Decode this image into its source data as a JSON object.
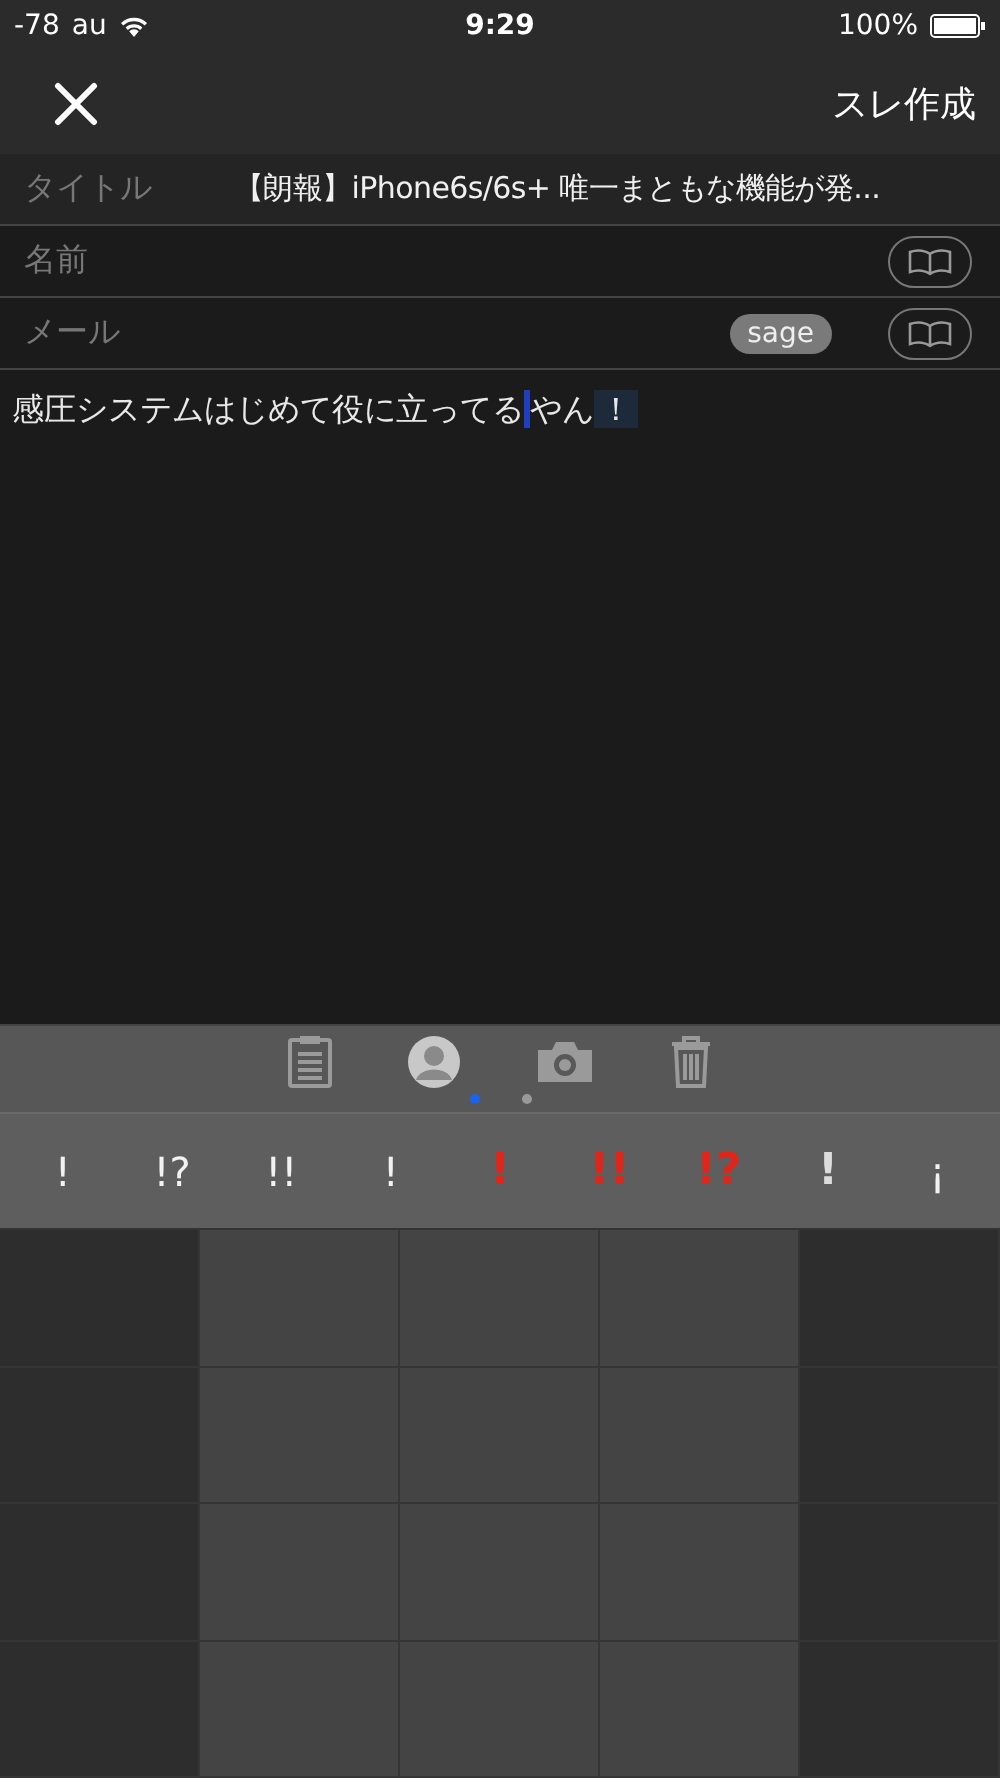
{
  "status_bar": {
    "signal": "-78",
    "carrier": "au",
    "time": "9:29",
    "battery": "100%"
  },
  "nav": {
    "title": "スレ作成"
  },
  "fields": [
    {
      "label": "タイトル",
      "value": "【朗報】iPhone6s/6s+ 唯一まともな機能が発...",
      "kind": "text"
    },
    {
      "label": "名前",
      "kind": "book"
    },
    {
      "label": "メール",
      "badge": "sage",
      "kind": "book"
    }
  ],
  "body": {
    "before_cursor": "感圧システムはじめて役に立ってる",
    "after_cursor": "やん",
    "marked": "！"
  },
  "toolbar": {
    "tools": [
      {
        "kind": "clipboard",
        "selected": false
      },
      {
        "kind": "person",
        "selected": true
      },
      {
        "kind": "camera",
        "selected": false
      },
      {
        "kind": "trash",
        "selected": false
      }
    ],
    "pages": [
      {
        "selected": true
      },
      {
        "selected": false
      }
    ]
  },
  "symbols": [
    {
      "text": "!",
      "kind": "plain"
    },
    {
      "text": "!?",
      "kind": "plain"
    },
    {
      "text": "!!",
      "kind": "plain"
    },
    {
      "text": "!",
      "kind": "plain"
    },
    {
      "text": "!",
      "kind": "red"
    },
    {
      "text": "!!",
      "kind": "red"
    },
    {
      "text": "!?",
      "kind": "red"
    },
    {
      "text": "!",
      "kind": "grey"
    },
    {
      "text": "¡",
      "kind": "plain"
    }
  ]
}
